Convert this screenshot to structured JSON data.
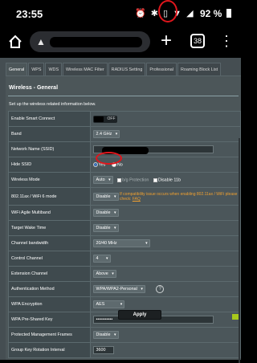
{
  "status_bar": {
    "time": "23:55",
    "battery_percent": "92 %",
    "icons": [
      "alarm-icon",
      "bluetooth-icon",
      "vibrate-icon",
      "wifi-icon",
      "signal-icon",
      "battery-icon"
    ]
  },
  "browser": {
    "url_warning_icon": "warning-icon",
    "tab_count": "38",
    "new_tab": "+",
    "menu": "⋮"
  },
  "tabs": [
    {
      "label": "General",
      "active": true
    },
    {
      "label": "WPS",
      "active": false
    },
    {
      "label": "WDS",
      "active": false
    },
    {
      "label": "Wireless MAC Filter",
      "active": false
    },
    {
      "label": "RADIUS Setting",
      "active": false
    },
    {
      "label": "Professional",
      "active": false
    },
    {
      "label": "Roaming Block List",
      "active": false
    }
  ],
  "page": {
    "title": "Wireless - General",
    "subtitle": "Set up the wireless related information below."
  },
  "settings": {
    "smart_connect": {
      "label": "Enable Smart Connect",
      "value": "OFF"
    },
    "band": {
      "label": "Band",
      "value": "2.4 GHz"
    },
    "ssid": {
      "label": "Network Name (SSID)"
    },
    "hide_ssid": {
      "label": "Hide SSID",
      "yes": "Yes",
      "no": "No",
      "selected": "Yes"
    },
    "wireless_mode": {
      "label": "Wireless Mode",
      "value": "Auto",
      "protection": "b/g Protection",
      "disable11b": "Disable 11b"
    },
    "wifi6_mode": {
      "label": "802.11ax / WiFi 6 mode",
      "value": "Disable",
      "note": "If compatibility issue occurs when enabling 802.11ax / WiFi",
      "note2": "please check:",
      "faq": "FAQ"
    },
    "agile_multiband": {
      "label": "WiFi Agile Multiband",
      "value": "Disable"
    },
    "target_wake": {
      "label": "Target Wake Time",
      "value": "Disable"
    },
    "bandwidth": {
      "label": "Channel bandwidth",
      "value": "20/40 MHz"
    },
    "control_channel": {
      "label": "Control Channel",
      "value": "4"
    },
    "extension_channel": {
      "label": "Extension Channel",
      "value": "Above"
    },
    "auth_method": {
      "label": "Authentication Method",
      "value": "WPA/WPA2-Personal"
    },
    "encryption": {
      "label": "WPA Encryption",
      "value": "AES"
    },
    "psk": {
      "label": "WPA Pre-Shared Key",
      "value": "•••••••••••"
    },
    "pmf": {
      "label": "Protected Management Frames",
      "value": "Disable"
    },
    "key_rotation": {
      "label": "Group Key Rotation Interval",
      "value": "3600"
    }
  },
  "apply_label": "Apply",
  "colors": {
    "panel_bg": "#454e52",
    "annotation_red": "#e0161c",
    "note_orange": "#f0a030",
    "key_green": "#a8c91c"
  }
}
